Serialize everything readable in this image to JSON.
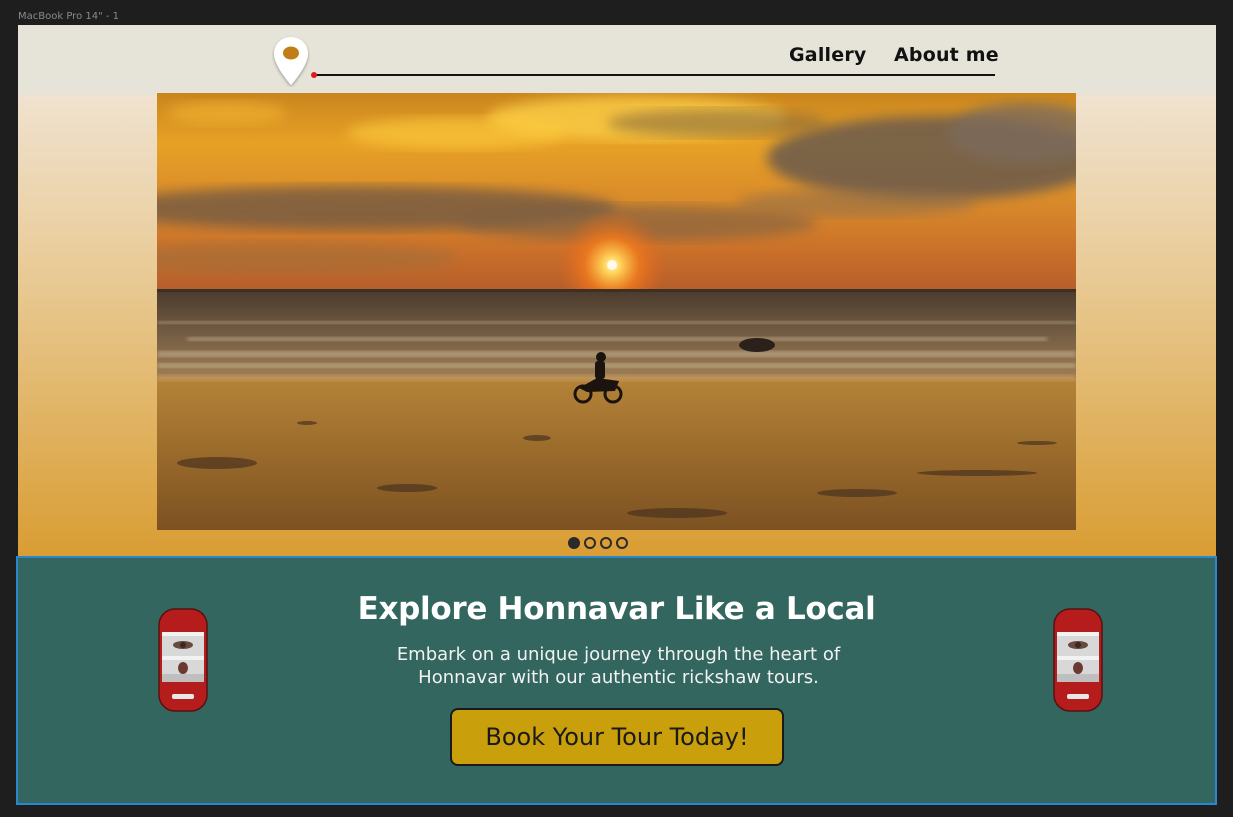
{
  "frame": {
    "label": "MacBook Pro 14\" - 1"
  },
  "header": {
    "logo_icon": "map-pin-icon",
    "nav": [
      {
        "label": "Gallery"
      },
      {
        "label": "About me"
      }
    ]
  },
  "hero": {
    "image": "sunset-beach-motorbike-photo",
    "slides_total": 4,
    "active_slide": 1
  },
  "cta": {
    "title": "Explore Honnavar Like a Local",
    "subtitle": "Embark on a unique journey through the heart of Honnavar with our authentic rickshaw tours.",
    "button_label": "Book Your Tour Today!",
    "decor_icon": "rickshaw-icon"
  },
  "colors": {
    "header_bg": "#e6e3d8",
    "cta_bg": "#32665f",
    "button_bg": "#c9a00c",
    "accent_red": "#e01b1b",
    "pin_orange": "#c27e16",
    "selection_outline": "#2a86d1"
  }
}
